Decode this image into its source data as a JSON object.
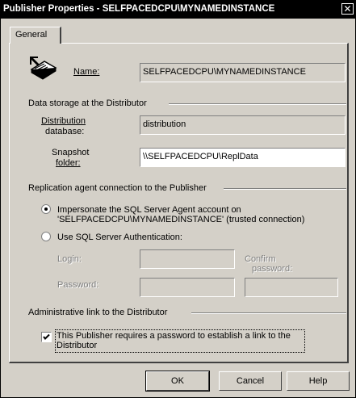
{
  "window": {
    "title": "Publisher Properties - SELFPACEDCPU\\MYNAMEDINSTANCE",
    "close_glyph": "✕"
  },
  "tabs": [
    {
      "label": "General"
    }
  ],
  "publisher": {
    "name_label": "Name:",
    "name_value": "SELFPACEDCPU\\MYNAMEDINSTANCE",
    "icon": "publisher-book-icon"
  },
  "data_storage": {
    "group_label": "Data storage at the Distributor",
    "db_label_line1": "Distribution",
    "db_label_line2": "database:",
    "db_value": "distribution",
    "snapshot_label_line1": "Snapshot",
    "snapshot_label_line2": "folder:",
    "snapshot_value": "\\\\SELFPACEDCPU\\ReplData"
  },
  "replication": {
    "group_label": "Replication agent connection to the Publisher",
    "impersonate_line1": "Impersonate the SQL Server Agent account on",
    "impersonate_line2": "'SELFPACEDCPU\\MYNAMEDINSTANCE' (trusted connection)",
    "impersonate_selected": true,
    "sql_auth_label": "Use SQL Server Authentication:",
    "sql_auth_selected": false,
    "login_label": "Login:",
    "login_value": "",
    "password_label": "Password:",
    "password_value": "",
    "confirm_line1": "Confirm",
    "confirm_line2": "password:",
    "confirm_value": ""
  },
  "admin_link": {
    "group_label": "Administrative link to the Distributor",
    "checkbox_line1": "This Publisher requires a password to establish a link to the",
    "checkbox_line2": "Distributor",
    "checked": true
  },
  "buttons": {
    "ok": "OK",
    "cancel": "Cancel",
    "help": "Help"
  }
}
